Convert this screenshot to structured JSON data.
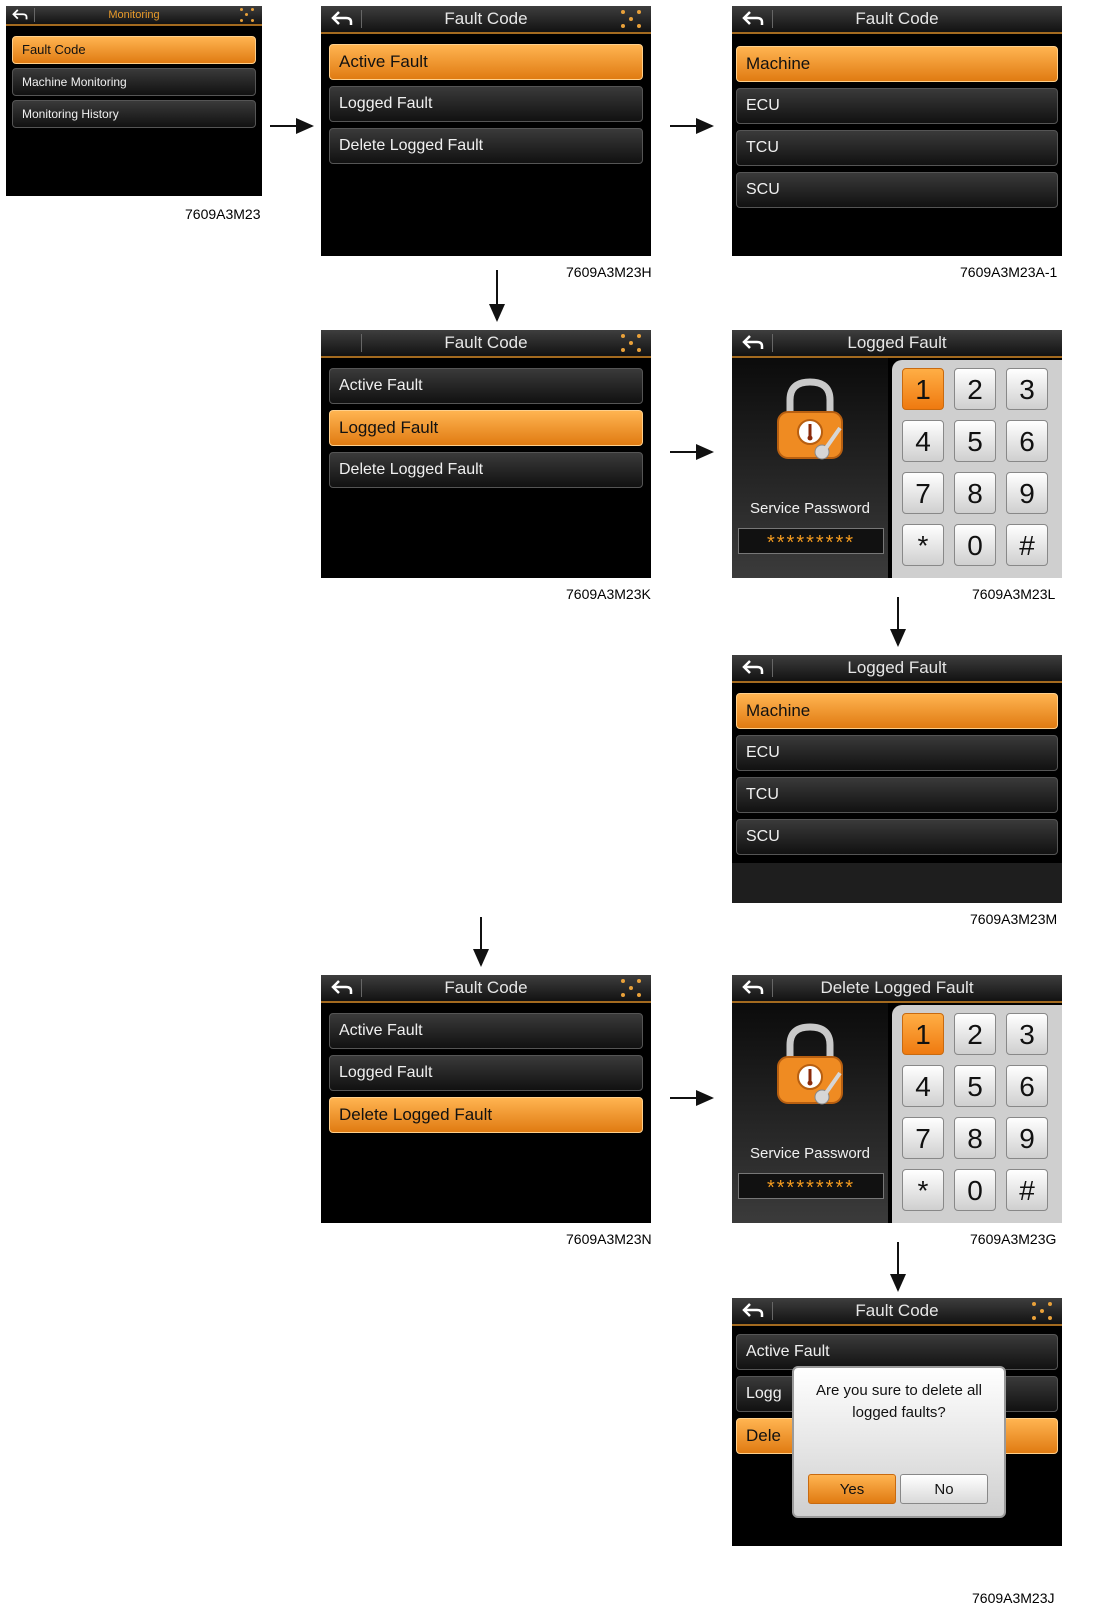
{
  "colors": {
    "accent": "#f29a1f",
    "selected_top": "#ffb451",
    "selected_bottom": "#e07b12",
    "screen_bg": "#000000"
  },
  "icons": {
    "back": "back-arrow-icon",
    "menu": "dots-menu-icon",
    "lock": "padlock-icon"
  },
  "screen_a": {
    "caption": "7609A3M23",
    "title": "Monitoring",
    "items": [
      "Fault Code",
      "Machine Monitoring",
      "Monitoring History"
    ],
    "selected": "Fault Code"
  },
  "screen_b": {
    "caption": "7609A3M23H",
    "title": "Fault Code",
    "items": [
      "Active Fault",
      "Logged Fault",
      "Delete Logged Fault"
    ],
    "selected": "Active Fault"
  },
  "screen_c": {
    "caption": "7609A3M23A-1",
    "title": "Fault Code",
    "items": [
      "Machine",
      "ECU",
      "TCU",
      "SCU"
    ],
    "selected": "Machine"
  },
  "screen_d": {
    "caption": "7609A3M23K",
    "title": "Fault Code",
    "items": [
      "Active Fault",
      "Logged Fault",
      "Delete Logged Fault"
    ],
    "selected": "Logged Fault"
  },
  "screen_e": {
    "caption": "7609A3M23L",
    "title": "Logged Fault",
    "password_label": "Service Password",
    "password_value": "*********",
    "keys": [
      "1",
      "2",
      "3",
      "4",
      "5",
      "6",
      "7",
      "8",
      "9",
      "*",
      "0",
      "#"
    ],
    "selected_key": "1"
  },
  "screen_f": {
    "caption": "7609A3M23M",
    "title": "Logged Fault",
    "items": [
      "Machine",
      "ECU",
      "TCU",
      "SCU"
    ],
    "selected": "Machine"
  },
  "screen_g": {
    "caption": "7609A3M23N",
    "title": "Fault Code",
    "items": [
      "Active Fault",
      "Logged Fault",
      "Delete Logged Fault"
    ],
    "selected": "Delete Logged Fault"
  },
  "screen_h": {
    "caption": "7609A3M23G",
    "title": "Delete Logged Fault",
    "password_label": "Service Password",
    "password_value": "*********",
    "keys": [
      "1",
      "2",
      "3",
      "4",
      "5",
      "6",
      "7",
      "8",
      "9",
      "*",
      "0",
      "#"
    ],
    "selected_key": "1"
  },
  "screen_i": {
    "caption": "7609A3M23J",
    "title": "Fault Code",
    "items_visible": [
      "Active Fault",
      "Logg",
      "Dele"
    ],
    "dialog_message": "Are you sure to delete all logged faults?",
    "yes_label": "Yes",
    "no_label": "No"
  }
}
